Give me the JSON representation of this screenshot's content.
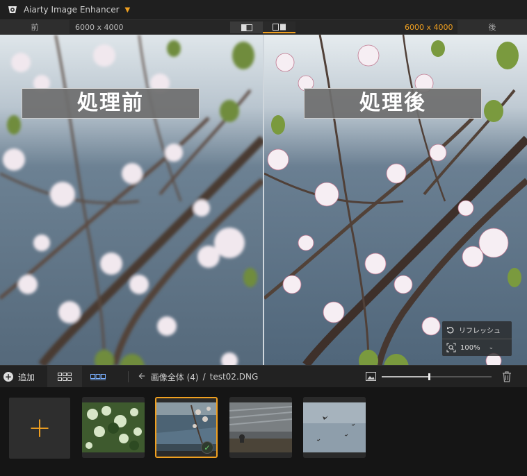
{
  "app": {
    "title": "Aiarty Image Enhancer",
    "accent_color": "#f0a020"
  },
  "compare": {
    "before_label": "前",
    "before_dimensions": "6000 x 4000",
    "after_dimensions": "6000 x 4000",
    "after_label": "後",
    "view_modes": [
      "single-view",
      "side-by-side-view"
    ],
    "active_view": "side-by-side-view"
  },
  "preview": {
    "before_overlay": "処理前",
    "after_overlay": "処理後",
    "refresh_label": "リフレッシュ",
    "zoom_level": "100%"
  },
  "toolbar": {
    "add_label": "追加",
    "breadcrumb_root": "画像全体 (4)",
    "breadcrumb_separator": "/",
    "breadcrumb_file": "test02.DNG",
    "thumbnail_size_fraction": 0.43
  },
  "thumbnails": [
    {
      "name": "green-foliage",
      "selected": false
    },
    {
      "name": "river-blossom",
      "selected": true
    },
    {
      "name": "stone-riverbank",
      "selected": false
    },
    {
      "name": "birds-sky",
      "selected": false
    }
  ]
}
